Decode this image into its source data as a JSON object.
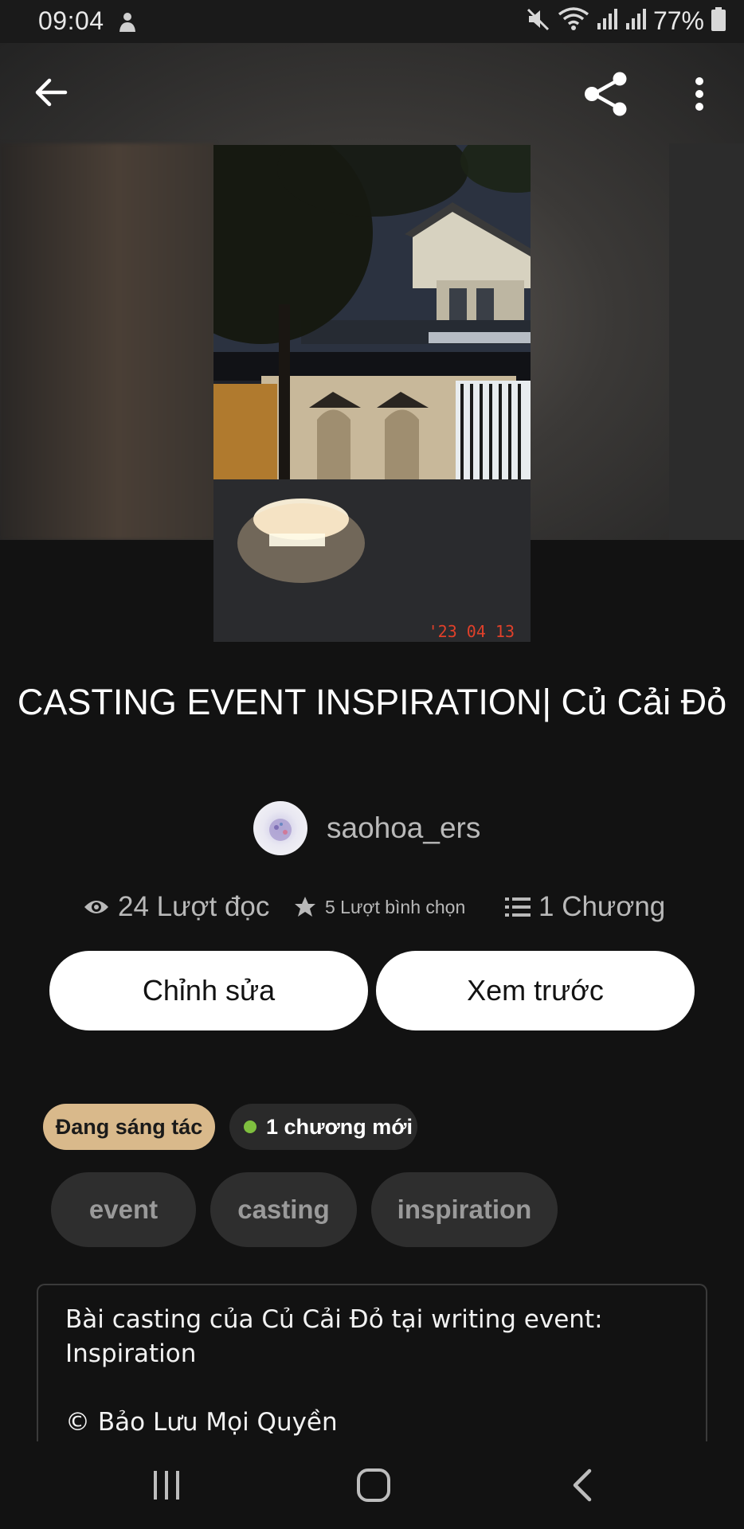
{
  "status_bar": {
    "time": "09:04",
    "battery": "77%",
    "icons": [
      "notification-icon",
      "mute-icon",
      "wifi-icon",
      "signal-icon",
      "signal-icon",
      "battery-icon"
    ]
  },
  "toolbar": {
    "back_icon": "arrow-left-icon",
    "share_icon": "share-icon",
    "more_icon": "more-vertical-icon"
  },
  "story": {
    "title": "CASTING EVENT INSPIRATION| Củ Cải Đỏ",
    "author": "saohoa_ers",
    "cover_stamp": "'23 04 13",
    "stats": {
      "reads": "24 Lượt đọc",
      "votes": "5 Lượt bình chọn",
      "chapters": "1 Chương"
    }
  },
  "actions": {
    "edit_label": "Chỉnh sửa",
    "preview_label": "Xem trước"
  },
  "badges": {
    "status": "Đang sáng tác",
    "new_chapters": "1 chương mới",
    "new_dot_color": "#7fbf3f"
  },
  "tags": [
    "event",
    "casting",
    "inspiration"
  ],
  "description": {
    "line1": "Bài casting của Củ Cải Đỏ tại writing event:",
    "line2": "Inspiration",
    "line3": "© Bảo Lưu Mọi Quyền"
  },
  "colors": {
    "background": "#121212",
    "button_bg": "#ffffff",
    "status_badge": "#d9b98b",
    "tag_bg": "#2e2e2e"
  },
  "nav": {
    "recent_icon": "recent-apps-icon",
    "home_icon": "home-icon",
    "back_icon": "back-icon"
  }
}
